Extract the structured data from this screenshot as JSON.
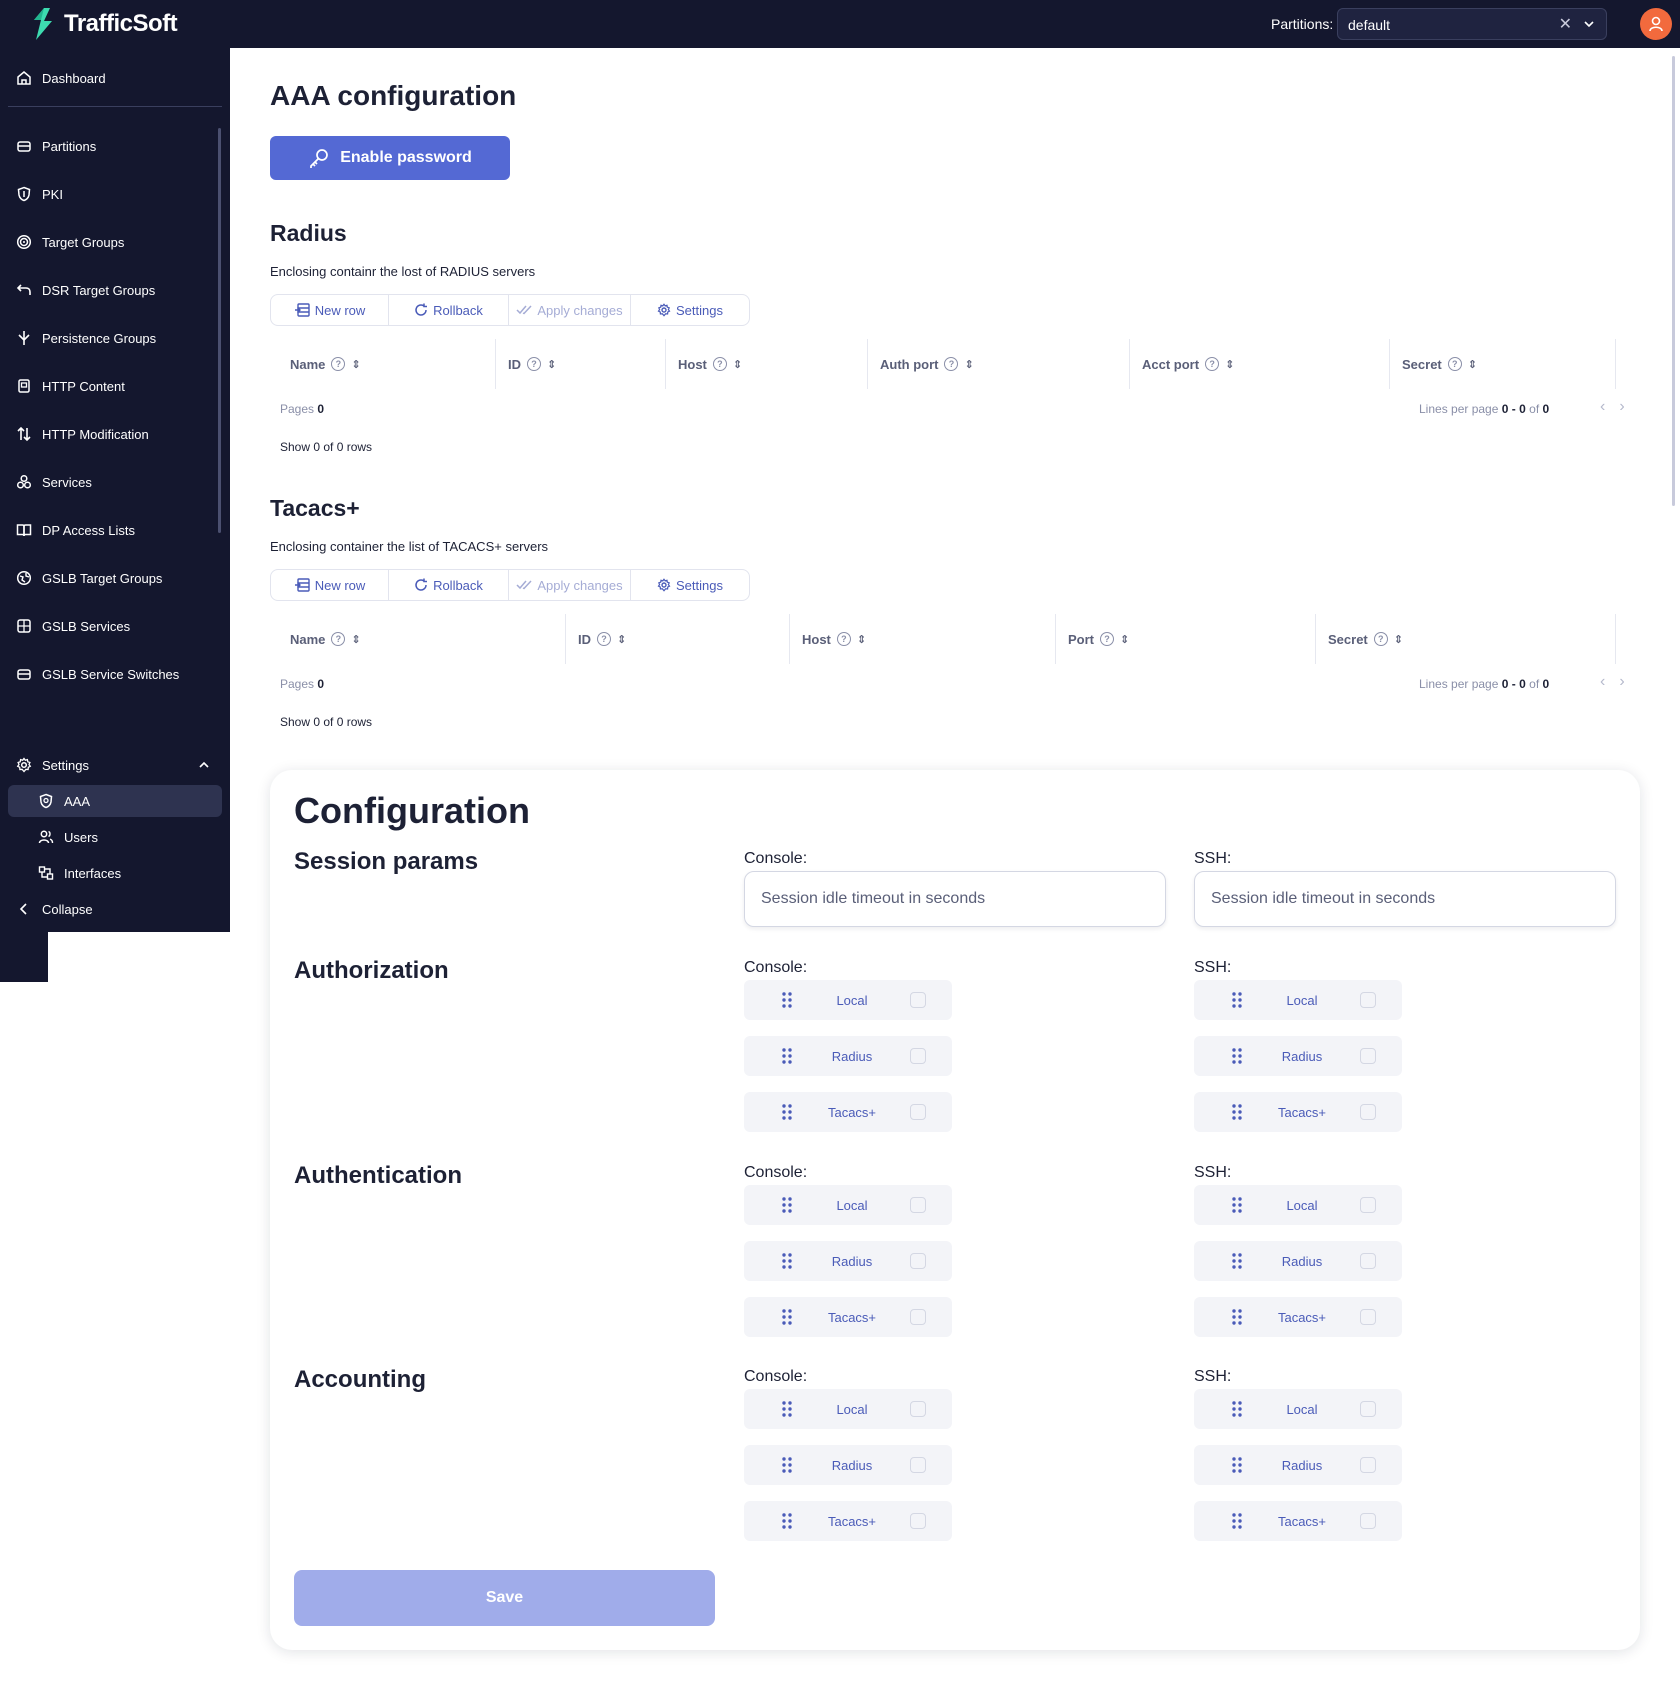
{
  "app": {
    "name": "TrafficSoft"
  },
  "header": {
    "partitions_label": "Partitions:",
    "partition_value": "default"
  },
  "sidebar": {
    "items": [
      {
        "label": "Dashboard",
        "icon": "home-icon"
      },
      {
        "label": "Partitions",
        "icon": "partitions-icon"
      },
      {
        "label": "PKI",
        "icon": "shield-icon"
      },
      {
        "label": "Target Groups",
        "icon": "target-icon"
      },
      {
        "label": "DSR Target Groups",
        "icon": "return-icon"
      },
      {
        "label": "Persistence Groups",
        "icon": "split-icon"
      },
      {
        "label": "HTTP Content",
        "icon": "content-icon"
      },
      {
        "label": "HTTP Modification",
        "icon": "arrows-icon"
      },
      {
        "label": "Services",
        "icon": "services-icon"
      },
      {
        "label": "DP Access Lists",
        "icon": "book-icon"
      },
      {
        "label": "GSLB Target Groups",
        "icon": "globe-icon"
      },
      {
        "label": "GSLB Services",
        "icon": "gslb-services-icon"
      },
      {
        "label": "GSLB Service Switches",
        "icon": "switch-icon"
      }
    ],
    "settings": {
      "label": "Settings",
      "sub": [
        "AAA",
        "Users",
        "Interfaces"
      ]
    },
    "collapse_label": "Collapse"
  },
  "page": {
    "title": "AAA configuration",
    "enable_password_label": "Enable password"
  },
  "toolbar": {
    "new_row": "New row",
    "rollback": "Rollback",
    "apply": "Apply changes",
    "settings": "Settings"
  },
  "radius": {
    "title": "Radius",
    "description": "Enclosing containr the lost of RADIUS servers",
    "columns": [
      "Name",
      "ID",
      "Host",
      "Auth port",
      "Acct port",
      "Secret"
    ],
    "pages_label": "Pages",
    "pages_value": "0",
    "lpp_label": "Lines per page",
    "range_from": "0",
    "range_sep": "-",
    "range_to": "0",
    "of_label": "of",
    "total": "0",
    "rows_info": "Show 0 of 0 rows"
  },
  "tacacs": {
    "title": "Tacacs+",
    "description": "Enclosing container the list of TACACS+ servers",
    "columns": [
      "Name",
      "ID",
      "Host",
      "Port",
      "Secret"
    ],
    "pages_label": "Pages",
    "pages_value": "0",
    "lpp_label": "Lines per page",
    "range_from": "0",
    "range_sep": "-",
    "range_to": "0",
    "of_label": "of",
    "total": "0",
    "rows_info": "Show 0 of 0 rows"
  },
  "config": {
    "title": "Configuration",
    "session_title": "Session params",
    "console_label": "Console:",
    "ssh_label": "SSH:",
    "session_placeholder": "Session idle timeout in seconds",
    "authorization_title": "Authorization",
    "authentication_title": "Authentication",
    "accounting_title": "Accounting",
    "methods": [
      "Local",
      "Radius",
      "Tacacs+"
    ],
    "save_label": "Save"
  },
  "colors": {
    "sidebar_bg": "#14172e",
    "accent": "#5469d4",
    "avatar": "#f26a3d",
    "logo": "#3ddbb0"
  }
}
